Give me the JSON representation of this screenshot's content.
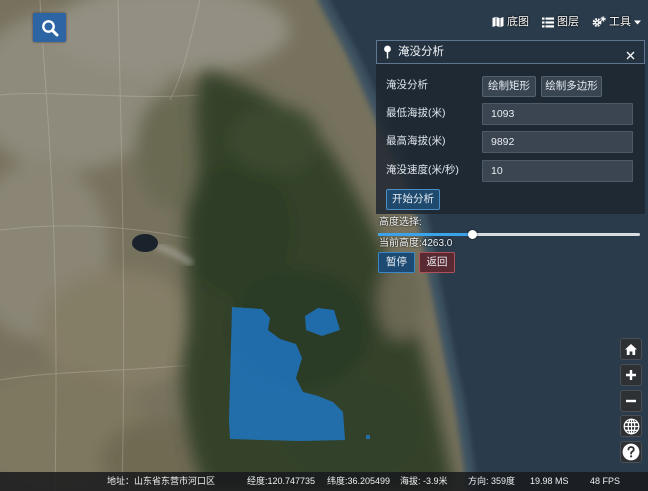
{
  "search": {
    "icon": "search-icon"
  },
  "toolbar": {
    "items": [
      {
        "label": "底图",
        "icon": "map-icon"
      },
      {
        "label": "图层",
        "icon": "layers-icon"
      },
      {
        "label": "工具",
        "icon": "tools-icon",
        "dropdown": true
      }
    ]
  },
  "panel": {
    "title": "淹没分析",
    "header_icon": "pin-icon",
    "close_icon": "close-icon",
    "draw_label": "淹没分析",
    "draw_rectangle": "绘制矩形",
    "draw_polygon": "绘制多边形",
    "fields": [
      {
        "label": "最低海拔(米)",
        "value": "1093"
      },
      {
        "label": "最高海拔(米)",
        "value": "9892"
      },
      {
        "label": "淹没速度(米/秒)",
        "value": "10"
      }
    ],
    "start": "开始分析",
    "height_select_label": "高度选择:",
    "height_slider": {
      "value": 4263.0
    },
    "current_height": "当前高度:4263.0",
    "pause": "暂停",
    "back": "返回"
  },
  "nav_controls": [
    {
      "icon": "home-icon"
    },
    {
      "icon": "zoom-in-icon"
    },
    {
      "icon": "zoom-out-icon"
    },
    {
      "icon": "globe-icon"
    },
    {
      "icon": "help-icon"
    }
  ],
  "status_bar": {
    "address": "地址：山东省东营市河口区",
    "longitude": "经度:120.747735",
    "latitude": "纬度:36.205499",
    "altitude": "海拔: -3.9米",
    "heading": "方向: 359度",
    "frame_time": "19.98 MS",
    "fps": "48 FPS"
  },
  "colors": {
    "search_button": "#2c64a4",
    "flood_area": "#1f78c8",
    "slider_fill": "#3aa3ea",
    "start_button": "#1f4a6e",
    "pause_button": "#1d4a72",
    "back_button": "#5a2a33"
  }
}
